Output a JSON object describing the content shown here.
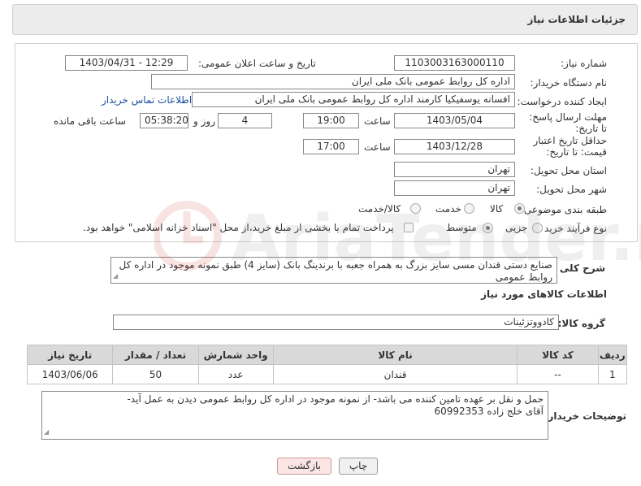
{
  "header": {
    "title": "جزئیات اطلاعات نیاز"
  },
  "form": {
    "need_number_label": "شماره نیاز:",
    "need_number": "1103003163000110",
    "announce_label": "تاریخ و ساعت اعلان عمومی:",
    "announce_value": "1403/04/31 - 12:29",
    "buyer_org_label": "نام دستگاه خریدار:",
    "buyer_org": "اداره کل روابط عمومی بانک ملی ایران",
    "requester_label": "ایجاد کننده درخواست:",
    "requester": "افسانه یوسفیکیا کارمند اداره کل روابط عمومی بانک ملی ایران",
    "contact_link": "اطلاعات تماس خریدار",
    "deadline_label": "مهلت ارسال پاسخ: تا تاریخ:",
    "deadline_date": "1403/05/04",
    "time_label": "ساعت",
    "deadline_time": "19:00",
    "days_value": "4",
    "days_label": "روز و",
    "remaining_time": "05:38:20",
    "remaining_label": "ساعت باقی مانده",
    "validity_label": "حداقل تاریخ اعتبار قیمت: تا تاریخ:",
    "validity_date": "1403/12/28",
    "validity_time": "17:00",
    "province_label": "استان محل تحویل:",
    "province": "تهران",
    "city_label": "شهر محل تحویل:",
    "city": "تهران",
    "category_label": "طبقه بندی موضوعی:",
    "category_options": [
      "کالا",
      "خدمت",
      "کالا/خدمت"
    ],
    "process_label": "نوع فرآیند خرید :",
    "process_options": [
      "جزیی",
      "متوسط"
    ],
    "payment_note": "پرداخت تمام یا بخشی از مبلغ خرید،از محل \"اسناد خزانه اسلامی\" خواهد بود."
  },
  "summary": {
    "label": "شرح کلی نیاز:",
    "text": "صنایع دستی قندان مسی سایز بزرگ به همراه جعبه با برندینگ بانک (سایز 4) طبق نمونه موجود در اداره کل روابط عمومی"
  },
  "goods": {
    "section_title": "اطلاعات کالاهای مورد نیاز",
    "group_label": "گروه کالا:",
    "group_value": "کادووتزئینات",
    "columns": [
      "ردیف",
      "کد کالا",
      "نام کالا",
      "واحد شمارش",
      "تعداد / مقدار",
      "تاریخ نیاز"
    ],
    "rows": [
      {
        "row": "1",
        "code": "--",
        "name": "قندان",
        "unit": "عدد",
        "qty": "50",
        "date": "1403/06/06"
      }
    ]
  },
  "buyer_notes": {
    "label": "توضیحات خریدار:",
    "line1": "حمل و نقل بر عهده تامین کننده می باشد- از نمونه موجود در اداره کل روابط عمومی دیدن به عمل آید-",
    "line2": "آقای خلج زاده 60992353"
  },
  "actions": {
    "print": "چاپ",
    "back": "بازگشت"
  },
  "watermark": "AriaTender.neT",
  "colors": {
    "link": "#1a4f9e",
    "header_bg": "#ececec",
    "table_header_bg": "#d9d9d9",
    "back_bg": "#fbe5e5"
  }
}
